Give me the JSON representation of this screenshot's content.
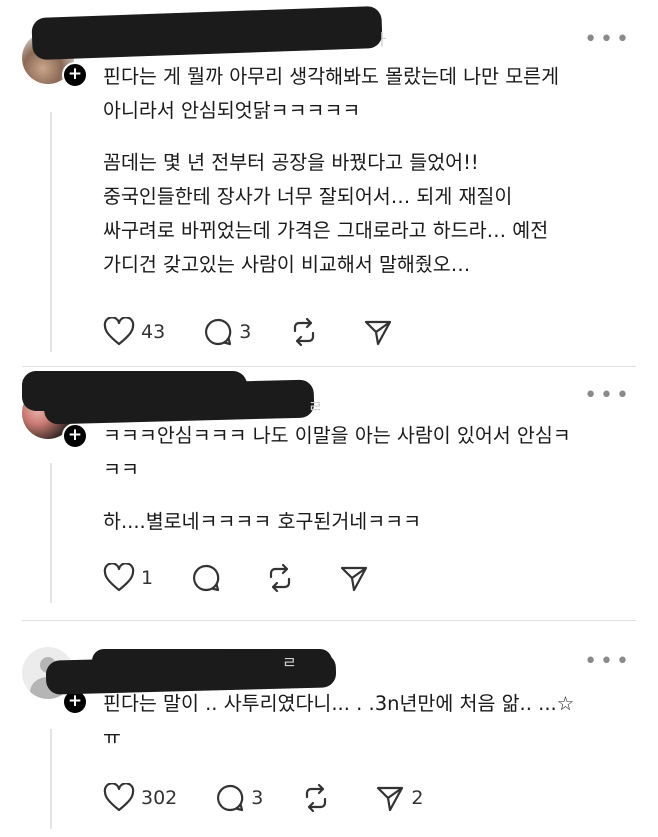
{
  "posts": [
    {
      "paragraphs": [
        "핀다는 게 뭘까 아무리 생각해봐도 몰랐는데 나만 모른게\n아니라서 안심되엇닭ㅋㅋㅋㅋㅋ",
        "꼼데는 몇 년 전부터 공장을 바꿨다고 들었어!!\n중국인들한테 장사가 너무 잘되어서… 되게 재질이\n싸구려로 바뀌었는데 가격은 그대로라고 하드라… 예전\n가디건 갖고있는 사람이 비교해서 말해줬오…"
      ],
      "likes": "43",
      "replies": "3",
      "reposts": "",
      "shares": ""
    },
    {
      "paragraphs": [
        "ㅋㅋㅋ안심ㅋㅋㅋ 나도 이말을 아는 사람이 있어서 안심ㅋ\nㅋㅋ",
        "하....별로네ㅋㅋㅋㅋ 호구된거네ㅋㅋㅋ"
      ],
      "likes": "1",
      "replies": "",
      "reposts": "",
      "shares": ""
    },
    {
      "paragraphs": [
        "핀다는 말이 .. 사투리였다니... . .3n년만에 처음 앎.. ...☆\nㅠ"
      ],
      "likes": "302",
      "replies": "3",
      "reposts": "",
      "shares": "2"
    }
  ],
  "icons": {
    "like": "heart-icon",
    "reply": "comment-bubble-icon",
    "repost": "repost-icon",
    "share": "send-icon",
    "more": "more-dots-icon",
    "follow": "plus-icon"
  },
  "colors": {
    "text": "#1a1a1a",
    "icon": "#333333",
    "divider": "#e0e0e0",
    "redaction": "#1b1b1b"
  }
}
